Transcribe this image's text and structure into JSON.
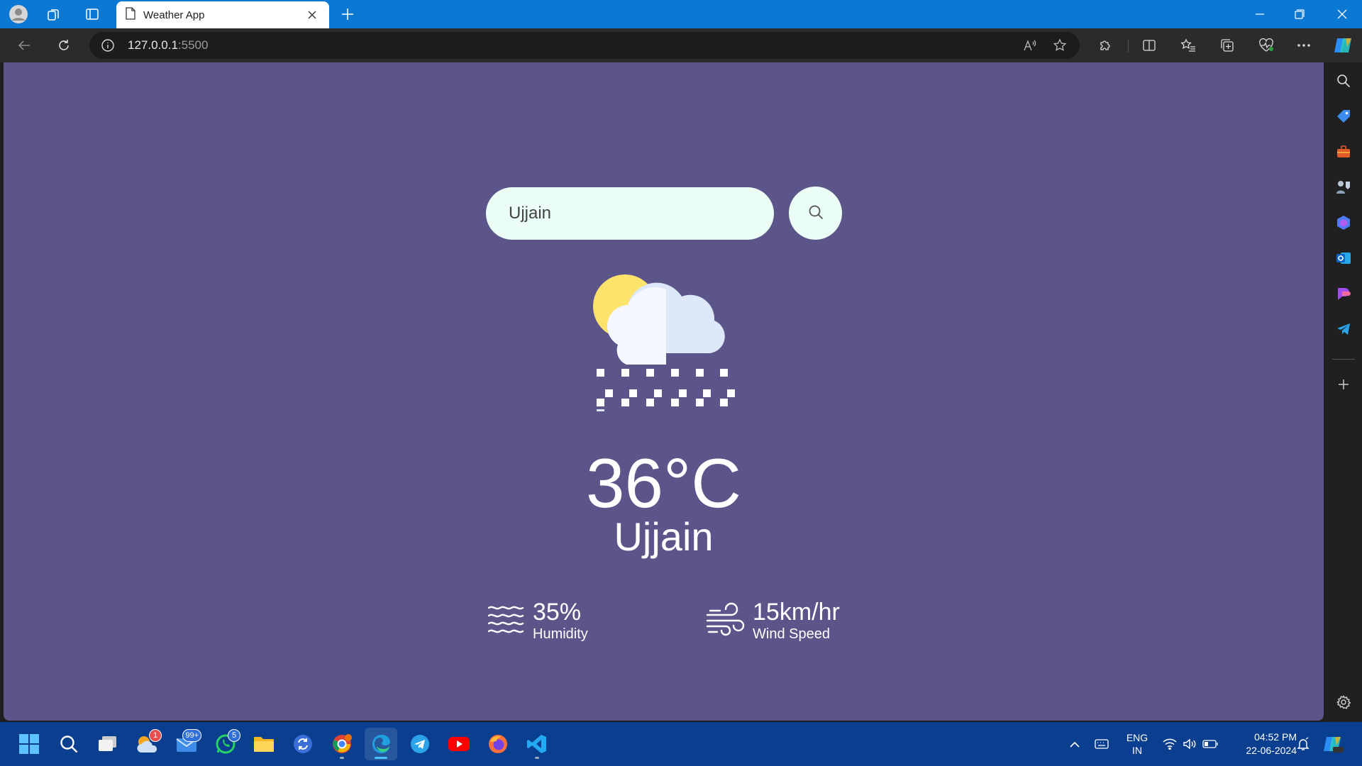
{
  "browser": {
    "tab_title": "Weather App",
    "url_host": "127.0.0.1",
    "url_port": ":5500"
  },
  "app": {
    "search": {
      "value": "Ujjain",
      "placeholder": ""
    },
    "temperature": "36°C",
    "city": "Ujjain",
    "humidity": {
      "value": "35%",
      "label": "Humidity"
    },
    "wind": {
      "value": "15km/hr",
      "label": "Wind Speed"
    },
    "condition_icon": "snow-cloud-sun-icon"
  },
  "taskbar": {
    "badges": {
      "photos": "1",
      "mail": "99+",
      "whatsapp": "5"
    },
    "language": {
      "line1": "ENG",
      "line2": "IN"
    },
    "time": "04:52 PM",
    "date": "22-06-2024"
  },
  "colors": {
    "page_background": "#5c5589",
    "input_background": "#ebfef5",
    "titlebar": "#0b78d4",
    "taskbar": "#0a3f8f"
  }
}
